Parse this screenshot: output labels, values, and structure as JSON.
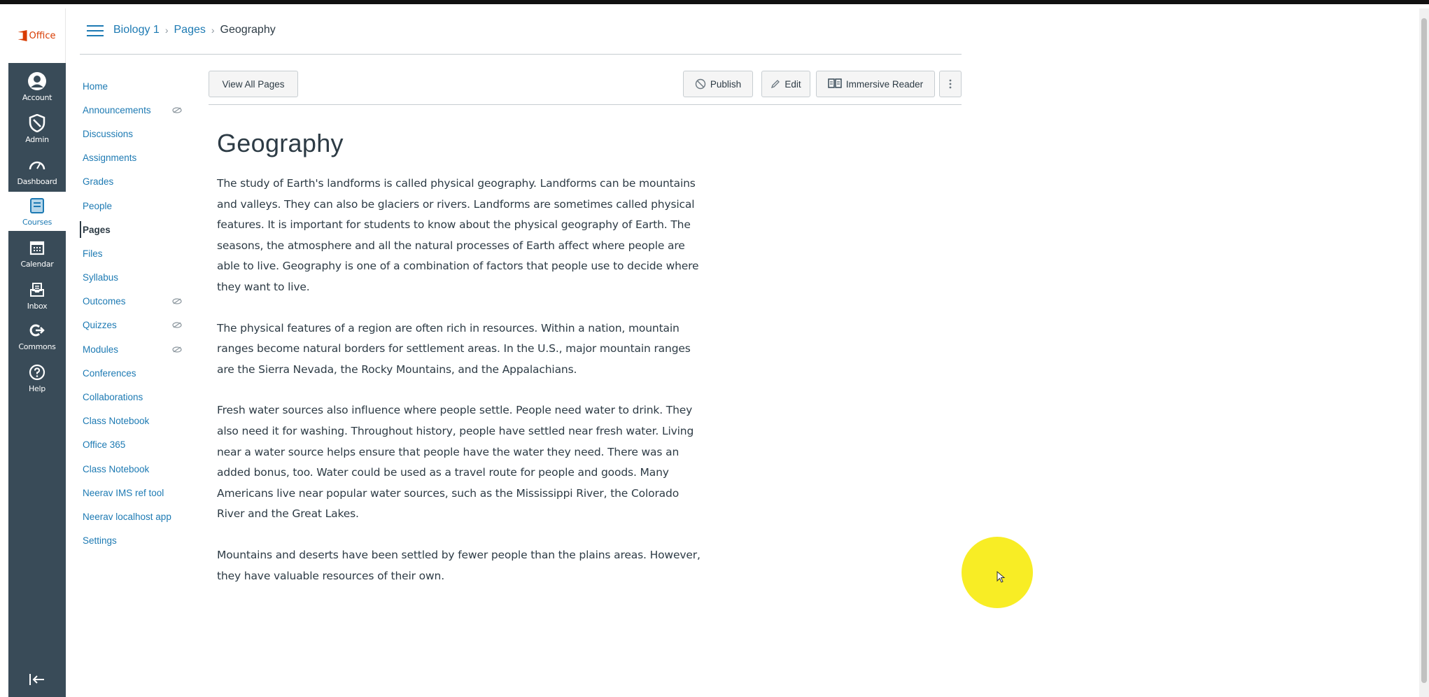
{
  "office": {
    "logo_text": "Office"
  },
  "global_nav": [
    {
      "label": "Account",
      "icon": "account-icon"
    },
    {
      "label": "Admin",
      "icon": "admin-shield-icon"
    },
    {
      "label": "Dashboard",
      "icon": "dashboard-icon"
    },
    {
      "label": "Courses",
      "icon": "courses-book-icon",
      "active": true
    },
    {
      "label": "Calendar",
      "icon": "calendar-icon"
    },
    {
      "label": "Inbox",
      "icon": "inbox-icon"
    },
    {
      "label": "Commons",
      "icon": "commons-icon"
    },
    {
      "label": "Help",
      "icon": "help-icon"
    }
  ],
  "breadcrumb": {
    "course": "Biology 1",
    "section": "Pages",
    "current": "Geography"
  },
  "course_nav": [
    {
      "label": "Home"
    },
    {
      "label": "Announcements",
      "hidden": true
    },
    {
      "label": "Discussions"
    },
    {
      "label": "Assignments"
    },
    {
      "label": "Grades"
    },
    {
      "label": "People"
    },
    {
      "label": "Pages",
      "active": true
    },
    {
      "label": "Files"
    },
    {
      "label": "Syllabus"
    },
    {
      "label": "Outcomes",
      "hidden": true
    },
    {
      "label": "Quizzes",
      "hidden": true
    },
    {
      "label": "Modules",
      "hidden": true
    },
    {
      "label": "Conferences"
    },
    {
      "label": "Collaborations"
    },
    {
      "label": "Class Notebook"
    },
    {
      "label": "Office 365"
    },
    {
      "label": "Class Notebook"
    },
    {
      "label": "Neerav IMS ref tool"
    },
    {
      "label": "Neerav localhost app"
    },
    {
      "label": "Settings"
    }
  ],
  "toolbar": {
    "view_all": "View All Pages",
    "publish": "Publish",
    "edit": "Edit",
    "immersive_reader": "Immersive Reader"
  },
  "page": {
    "title": "Geography",
    "paragraphs": [
      "The study of Earth's landforms is called physical geography. Landforms can be mountains and valleys. They can also be glaciers or rivers. Landforms are sometimes called physical features. It is important for students to know about the physical geography of Earth. The seasons, the atmosphere and all the natural processes of Earth affect where people are able to live. Geography is one of a combination of factors that people use to decide where they want to live.",
      "The physical features of a region are often rich in resources. Within a nation, mountain ranges become natural borders for settlement areas. In the U.S., major mountain ranges are the Sierra Nevada, the Rocky Mountains, and the Appalachians.",
      "Fresh water sources also influence where people settle. People need water to drink. They also need it for washing. Throughout history, people have settled near fresh water. Living near a water source helps ensure that people have the water they need. There was an added bonus, too. Water could be used as a travel route for people and goods. Many Americans live near popular water sources, such as the Mississippi River, the Colorado River and the Great Lakes.",
      "Mountains and deserts have been settled by fewer people than the plains areas. However, they have valuable resources of their own."
    ]
  },
  "colors": {
    "nav_bg": "#394b58",
    "link": "#1d7ab3",
    "text": "#2d3b45",
    "office": "#d83b01",
    "cursor_highlight": "#f7ec12"
  }
}
